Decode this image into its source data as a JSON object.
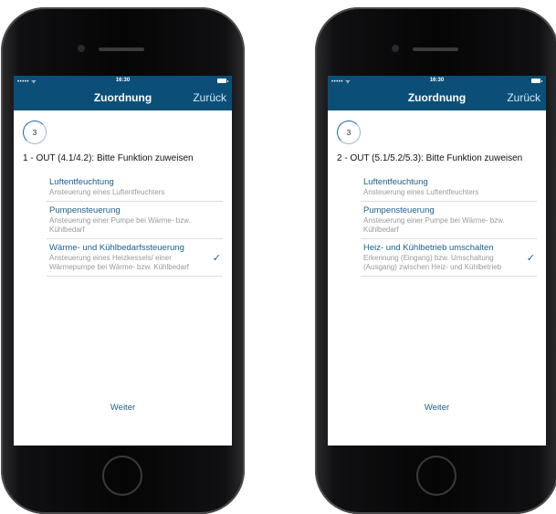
{
  "phones": [
    {
      "status": {
        "signal": "••••• ᯤ",
        "time": "16:30"
      },
      "nav": {
        "title": "Zuordnung",
        "back": "Zurück"
      },
      "step": "3",
      "heading": "1 - OUT (4.1/4.2): Bitte Funktion zuweisen",
      "options": [
        {
          "title": "Luftentfeuchtung",
          "desc": "Ansteuerung eines Luftentfeuchters",
          "selected": false
        },
        {
          "title": "Pumpensteuerung",
          "desc": "Ansteuerung einer Pumpe bei Wärme- bzw. Kühlbedarf",
          "selected": false
        },
        {
          "title": "Wärme- und Kühlbedarfssteuerung",
          "desc": "Ansteuerung eines Heizkessels/ einer Wärmepumpe bei Wärme- bzw. Kühlbedarf",
          "selected": true,
          "check": "✓"
        }
      ],
      "next": "Weiter"
    },
    {
      "status": {
        "signal": "••••• ᯤ",
        "time": "16:30"
      },
      "nav": {
        "title": "Zuordnung",
        "back": "Zurück"
      },
      "step": "3",
      "heading": "2 - OUT (5.1/5.2/5.3): Bitte Funktion zuweisen",
      "options": [
        {
          "title": "Luftentfeuchtung",
          "desc": "Ansteuerung eines Luftentfeuchters",
          "selected": false
        },
        {
          "title": "Pumpensteuerung",
          "desc": "Ansteuerung einer Pumpe bei Wärme- bzw. Kühlbedarf",
          "selected": false
        },
        {
          "title": "Heiz- und Kühlbetrieb umschalten",
          "desc": "Erkennung (Eingang) bzw. Umschaltung (Ausgang) zwischen Heiz- und Kühlbetrieb",
          "selected": true,
          "check": "✓"
        }
      ],
      "next": "Weiter"
    }
  ],
  "colors": {
    "navbar": "#0b4f78",
    "accent": "#1a5f8e"
  }
}
